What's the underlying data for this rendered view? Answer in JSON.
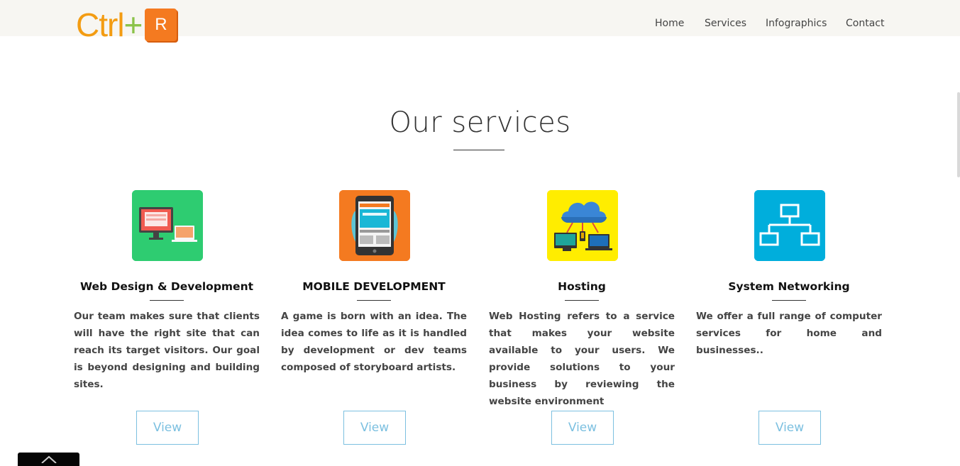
{
  "header": {
    "logo": {
      "text": "Ctrl",
      "plus": "+",
      "key": "R"
    },
    "nav": [
      {
        "label": "Home"
      },
      {
        "label": "Services"
      },
      {
        "label": "Infographics"
      },
      {
        "label": "Contact"
      }
    ]
  },
  "section": {
    "title": "Our services"
  },
  "services": [
    {
      "title": "Web Design & Development",
      "icon": "web-design-icon",
      "icon_bg": "#2ecc71",
      "text": "Our team makes sure that clients will have the right site that can reach its target visitors. Our goal is beyond designing and building sites.",
      "button": "View"
    },
    {
      "title": "MOBILE DEVELOPMENT",
      "icon": "mobile-tablet-icon",
      "icon_bg": "#f47a20",
      "text": "A game is born with an idea. The idea comes to life as it is handled by development or dev teams composed of storyboard artists.",
      "button": "View"
    },
    {
      "title": "Hosting",
      "icon": "cloud-hosting-icon",
      "icon_bg": "#ffed00",
      "text": "Web Hosting refers to a service that makes your website available to your users. We provide solutions to your business by reviewing the website environment",
      "button": "View"
    },
    {
      "title": "System Networking",
      "icon": "network-diagram-icon",
      "icon_bg": "#00aedc",
      "text": "We offer a full range of computer services for home and businesses..",
      "button": "View"
    }
  ],
  "colors": {
    "topbar": "#f7f6f2",
    "accent": "#7cc0e0",
    "logo_orange": "#f39c12",
    "logo_green": "#8bc34a"
  }
}
